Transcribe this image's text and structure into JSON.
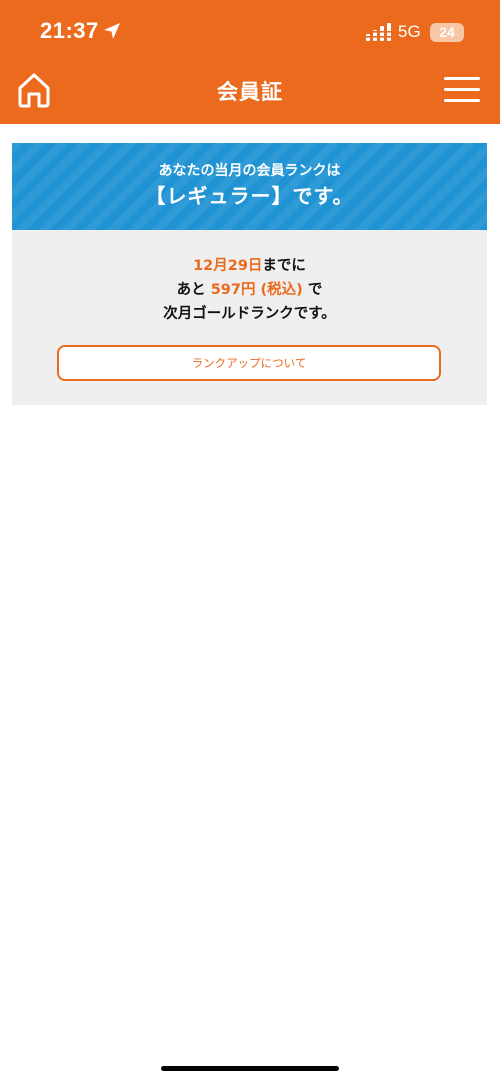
{
  "status_bar": {
    "time": "21:37",
    "network": "5G",
    "battery": "24"
  },
  "nav": {
    "title": "会員証"
  },
  "rank_banner": {
    "intro": "あなたの当月の会員ランクは",
    "rank": "【レギュラー】です。"
  },
  "rank_info": {
    "deadline": "12月29日",
    "deadline_suffix": "までに",
    "amount_prefix": "あと",
    "amount": "597円",
    "tax_note": "(税込)",
    "amount_suffix": "で",
    "next_rank_text": "次月ゴールドランクです。",
    "button_label": "ランクアップについて"
  },
  "colors": {
    "brand": "#ec6a1e",
    "banner": "#1f93d3",
    "panel": "#efefef"
  },
  "icons": {
    "home": "home-icon",
    "menu": "hamburger-menu-icon",
    "location": "location-arrow-icon",
    "signal": "cellular-signal-icon"
  }
}
